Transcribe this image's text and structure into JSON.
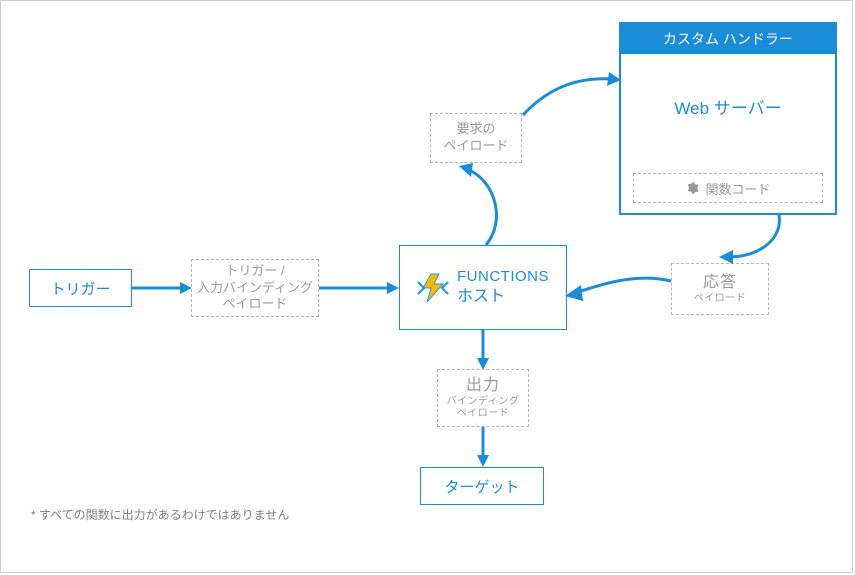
{
  "nodes": {
    "trigger": "トリガー",
    "trigger_payload_l1": "トリガー /",
    "trigger_payload_l2": "入力バインディング",
    "trigger_payload_l3": "ペイロード",
    "functions_top": "FUNCTIONS",
    "functions_bottom": "ホスト",
    "request_payload_l1": "要求の",
    "request_payload_l2": "ペイロード",
    "response_big": "応答",
    "response_small": "ペイロード",
    "output_big": "出力",
    "output_s1": "バインディング",
    "output_s2": "ペイロード",
    "target": "ターゲット",
    "handler_title": "カスタム ハンドラー",
    "web_server": "Web サーバー",
    "fn_code": "関数コード"
  },
  "footnote": "* すべての関数に出力があるわけではありません",
  "colors": {
    "azure": "#1a8cd8",
    "grey": "#9a9a9a"
  }
}
